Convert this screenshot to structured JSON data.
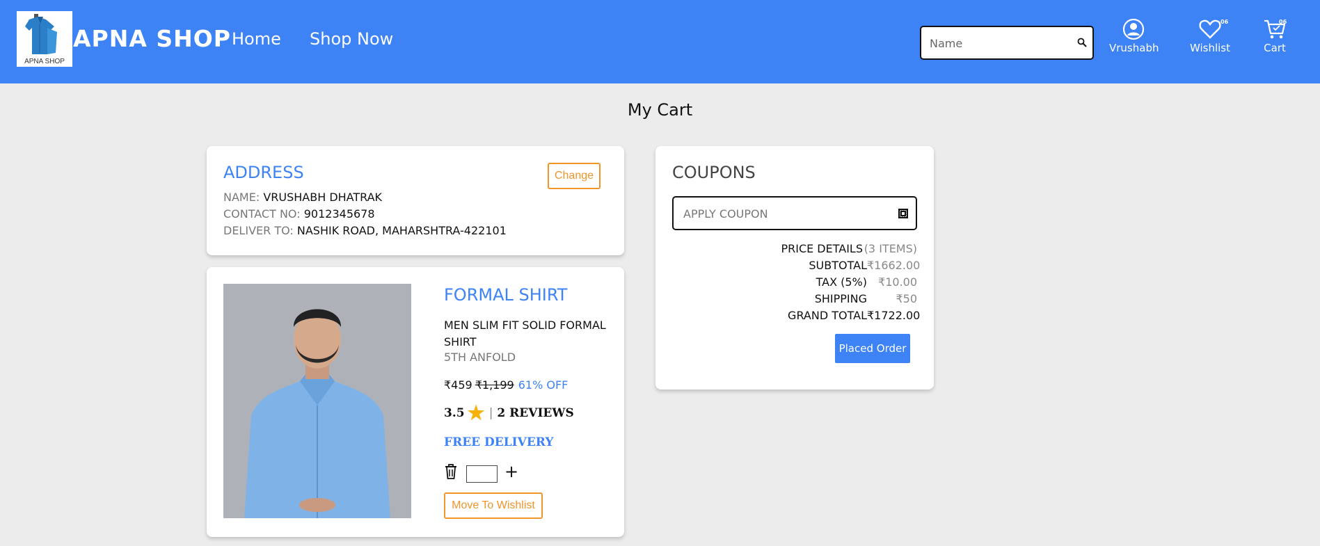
{
  "header": {
    "logo_caption": "APNA SHOP",
    "brand": "APNA SHOP",
    "nav": [
      {
        "label": "Home"
      },
      {
        "label": "Shop Now"
      }
    ],
    "search_placeholder": "Name",
    "user_label": "Vrushabh",
    "wishlist_label": "Wishlist",
    "wishlist_count": "06",
    "cart_label": "Cart",
    "cart_count": "06",
    "accent_color": "#3d83f6"
  },
  "page_title": "My Cart",
  "address": {
    "title": "ADDRESS",
    "change_label": "Change",
    "name_label": "NAME:",
    "name_value": "VRUSHABH DHATRAK",
    "contact_label": "CONTACT NO:",
    "contact_value": "9012345678",
    "deliver_label": "DELIVER TO:",
    "deliver_value": "NASHIK ROAD, MAHARSHTRA-422101"
  },
  "product": {
    "title": "FORMAL SHIRT",
    "description": "MEN SLIM FIT SOLID FORMAL SHIRT",
    "brand": "5TH ANFOLD",
    "price": "₹459",
    "original_price": "₹1,199",
    "discount": "61% OFF",
    "rating": "3.5",
    "reviews": "2 REVIEWS",
    "delivery": "FREE DELIVERY",
    "quantity": "",
    "move_to_wishlist_label": "Move To Wishlist",
    "icons": [
      "trash-icon",
      "plus-icon",
      "star-icon"
    ]
  },
  "coupons": {
    "title": "COUPONS",
    "placeholder": "APPLY COUPON",
    "price_details_label": "PRICE DETAILS",
    "price_details_items": "(3 ITEMS)",
    "subtotal_label": "SUBTOTAL",
    "subtotal_value": "₹1662.00",
    "tax_label": "TAX (5%)",
    "tax_value": "₹10.00",
    "shipping_label": "SHIPPING",
    "shipping_value": "₹50",
    "grand_total_label": "GRAND TOTAL",
    "grand_total_value": "₹1722.00",
    "place_order_label": "Placed Order"
  }
}
